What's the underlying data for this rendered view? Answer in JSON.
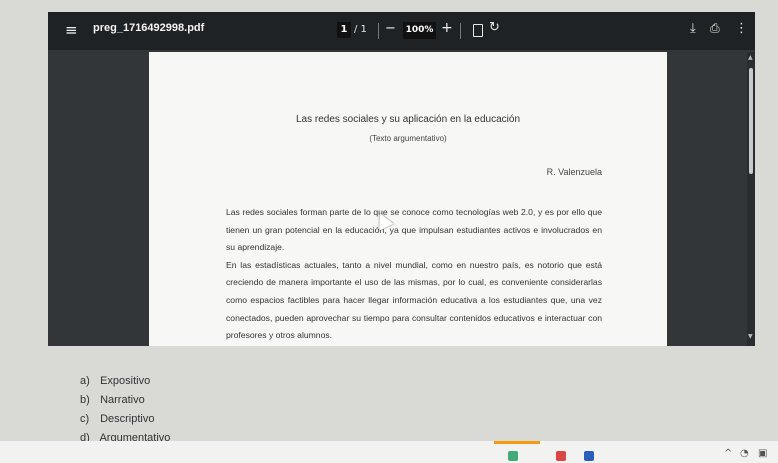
{
  "viewer": {
    "title": "preg_1716492998.pdf",
    "page_current": "1",
    "page_total": "/ 1",
    "zoom_minus": "−",
    "zoom": "100%",
    "zoom_plus": "+",
    "menu_icon": "≡",
    "rotate_icon": "↻",
    "download_icon": "⤓",
    "print_icon": "⎙",
    "more_icon": "⋮"
  },
  "document": {
    "title": "Las redes sociales y su aplicación en la educación",
    "subtitle": "(Texto argumentativo)",
    "author": "R. Valenzuela",
    "paragraphs": [
      "Las redes sociales forman parte de lo que se conoce como tecnologías web 2.0, y es por ello que tienen un gran potencial en la educación, ya que impulsan estudiantes activos e involucrados en su aprendizaje.",
      "En las estadísticas actuales, tanto a nivel mundial, como en nuestro país, es notorio que está creciendo de manera importante el uso de las mismas, por lo cual, es conveniente considerarlas como espacios factibles para hacer llegar información educativa a los estudiantes que, una vez conectados, pueden aprovechar su tiempo para consultar contenidos educativos e interactuar con profesores y otros alumnos."
    ]
  },
  "options": [
    {
      "letter": "a)",
      "label": "Expositivo"
    },
    {
      "letter": "b)",
      "label": "Narrativo"
    },
    {
      "letter": "c)",
      "label": "Descriptivo"
    },
    {
      "letter": "d)",
      "label": "Argumentativo"
    }
  ],
  "colors": {
    "toolbar": "#1f2224",
    "viewer_bg": "#323639",
    "page": "#f7f7f5",
    "accent": "#f39c12"
  }
}
